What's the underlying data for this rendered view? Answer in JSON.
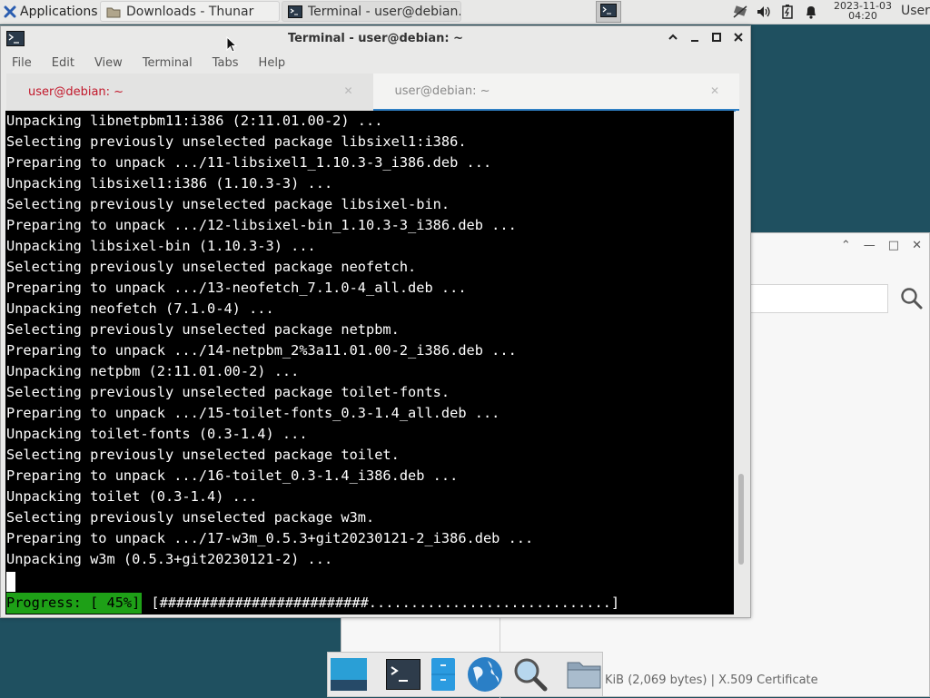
{
  "top_panel": {
    "applications_label": "Applications",
    "tasks": [
      {
        "label": "Downloads - Thunar",
        "icon": "folder-icon",
        "active": false
      },
      {
        "label": "Terminal - user@debian...",
        "icon": "terminal-icon",
        "active": true
      }
    ],
    "tray_icons": [
      "network-icon",
      "volume-icon",
      "battery-icon",
      "notification-bell-icon"
    ],
    "clock_date": "2023-11-03",
    "clock_time": "04:20",
    "user": "User"
  },
  "terminal": {
    "title": "Terminal - user@debian: ~",
    "menu": [
      "File",
      "Edit",
      "View",
      "Terminal",
      "Tabs",
      "Help"
    ],
    "tabs": [
      {
        "label": "user@debian: ~",
        "active": false
      },
      {
        "label": "user@debian: ~",
        "active": true
      }
    ],
    "lines": [
      "Unpacking libnetpbm11:i386 (2:11.01.00-2) ...",
      "Selecting previously unselected package libsixel1:i386.",
      "Preparing to unpack .../11-libsixel1_1.10.3-3_i386.deb ...",
      "Unpacking libsixel1:i386 (1.10.3-3) ...",
      "Selecting previously unselected package libsixel-bin.",
      "Preparing to unpack .../12-libsixel-bin_1.10.3-3_i386.deb ...",
      "Unpacking libsixel-bin (1.10.3-3) ...",
      "Selecting previously unselected package neofetch.",
      "Preparing to unpack .../13-neofetch_7.1.0-4_all.deb ...",
      "Unpacking neofetch (7.1.0-4) ...",
      "Selecting previously unselected package netpbm.",
      "Preparing to unpack .../14-netpbm_2%3a11.01.00-2_i386.deb ...",
      "Unpacking netpbm (2:11.01.00-2) ...",
      "Selecting previously unselected package toilet-fonts.",
      "Preparing to unpack .../15-toilet-fonts_0.3-1.4_all.deb ...",
      "Unpacking toilet-fonts (0.3-1.4) ...",
      "Selecting previously unselected package toilet.",
      "Preparing to unpack .../16-toilet_0.3-1.4_i386.deb ...",
      "Unpacking toilet (0.3-1.4) ...",
      "Selecting previously unselected package w3m.",
      "Preparing to unpack .../17-w3m_0.5.3+git20230121-2_i386.deb ...",
      "Unpacking w3m (0.5.3+git20230121-2) ..."
    ],
    "progress_label": "Progress: [ 45%]",
    "progress_bar": "[#########################.............................]",
    "progress_fraction": 0.45,
    "scroll_position": 0.88
  },
  "thunar_background": {
    "status_text": "KiB (2,069 bytes)  |  X.509 Certificate"
  },
  "dock": {
    "items": [
      "show-desktop-icon",
      "terminal-icon",
      "file-manager-icon",
      "web-browser-icon",
      "app-finder-icon",
      "home-folder-icon"
    ]
  },
  "colors": {
    "desktop": "#1f5060",
    "progress_green": "#1ea017",
    "tab_active_underline": "#2f7fc4",
    "tab_inactive_text": "#c2182b"
  }
}
